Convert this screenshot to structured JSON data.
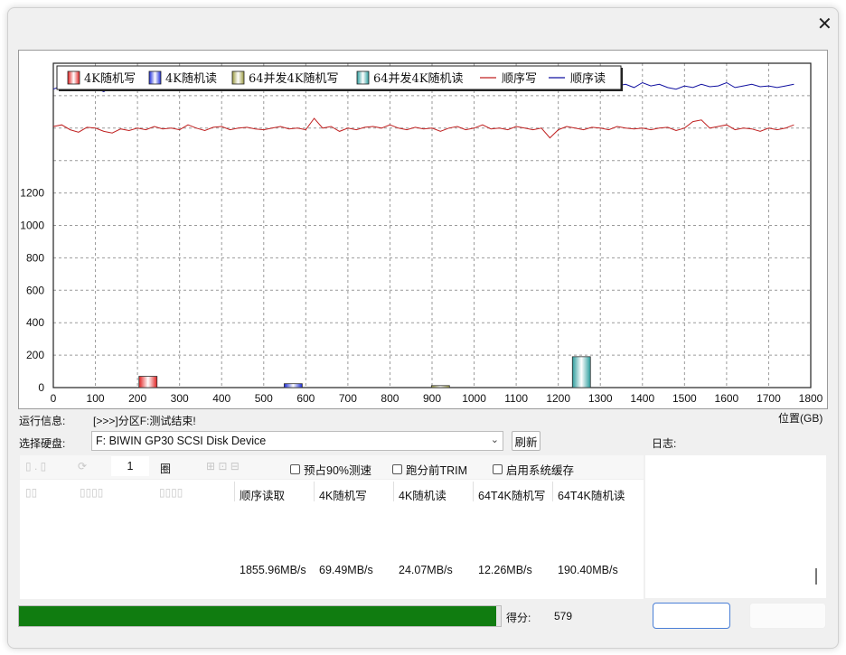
{
  "window": {
    "close_glyph": "✕"
  },
  "chart_data": {
    "type": "bar",
    "legend": [
      "4K随机写",
      "4K随机读",
      "64并发4K随机写",
      "64并发4K随机读",
      "顺序写",
      "顺序读"
    ],
    "legend_position": "top-left",
    "xlabel": "位置(GB)",
    "x_ticks": [
      0,
      100,
      200,
      300,
      400,
      500,
      600,
      700,
      800,
      900,
      1000,
      1100,
      1200,
      1300,
      1400,
      1500,
      1600,
      1700,
      1800
    ],
    "y_ticks": [
      0,
      200,
      400,
      600,
      800,
      1000,
      1200
    ],
    "xlim": [
      0,
      1800
    ],
    "ylim": [
      0,
      2000
    ],
    "grid": true,
    "bars": [
      {
        "name": "4K随机写",
        "x": 225,
        "value": 69.49,
        "color": "#e02020"
      },
      {
        "name": "4K随机读",
        "x": 570,
        "value": 24.07,
        "color": "#1a2ad8"
      },
      {
        "name": "64并发4K随机写",
        "x": 920,
        "value": 12.26,
        "color": "#9a9a40"
      },
      {
        "name": "64并发4K随机读",
        "x": 1255,
        "value": 190.4,
        "color": "#2a9c9c"
      }
    ],
    "series": [
      {
        "name": "顺序写",
        "color": "#c02020",
        "x": [
          0,
          20,
          40,
          60,
          80,
          100,
          120,
          140,
          160,
          180,
          200,
          220,
          240,
          260,
          280,
          300,
          320,
          340,
          360,
          380,
          400,
          420,
          440,
          460,
          480,
          500,
          520,
          540,
          560,
          580,
          600,
          620,
          640,
          660,
          680,
          700,
          720,
          740,
          760,
          780,
          800,
          820,
          840,
          860,
          880,
          900,
          920,
          940,
          960,
          980,
          1000,
          1020,
          1040,
          1060,
          1080,
          1100,
          1120,
          1140,
          1160,
          1180,
          1200,
          1220,
          1240,
          1260,
          1280,
          1300,
          1320,
          1340,
          1360,
          1380,
          1400,
          1420,
          1440,
          1460,
          1480,
          1500,
          1520,
          1540,
          1560,
          1580,
          1600,
          1620,
          1640,
          1660,
          1680,
          1700,
          1720,
          1740,
          1760
        ],
        "values": [
          1610,
          1620,
          1590,
          1575,
          1605,
          1600,
          1580,
          1570,
          1595,
          1585,
          1600,
          1590,
          1610,
          1595,
          1600,
          1590,
          1620,
          1600,
          1585,
          1605,
          1610,
          1590,
          1600,
          1605,
          1595,
          1590,
          1600,
          1610,
          1595,
          1600,
          1590,
          1660,
          1600,
          1610,
          1580,
          1600,
          1590,
          1605,
          1610,
          1600,
          1620,
          1600,
          1590,
          1605,
          1595,
          1600,
          1580,
          1600,
          1610,
          1590,
          1600,
          1620,
          1595,
          1600,
          1590,
          1610,
          1600,
          1590,
          1600,
          1540,
          1590,
          1610,
          1600,
          1590,
          1605,
          1600,
          1590,
          1610,
          1600,
          1595,
          1600,
          1590,
          1600,
          1605,
          1585,
          1600,
          1640,
          1650,
          1600,
          1610,
          1620,
          1590,
          1600,
          1595,
          1580,
          1600,
          1590,
          1600,
          1620
        ]
      },
      {
        "name": "顺序读",
        "color": "#1010a0",
        "x": [
          0,
          20,
          40,
          60,
          80,
          100,
          120,
          140,
          160,
          180,
          200,
          220,
          240,
          260,
          280,
          300,
          320,
          340,
          360,
          380,
          400,
          420,
          440,
          460,
          480,
          500,
          520,
          540,
          560,
          580,
          600,
          620,
          640,
          660,
          680,
          700,
          720,
          740,
          760,
          780,
          800,
          820,
          840,
          860,
          880,
          900,
          920,
          940,
          960,
          980,
          1000,
          1020,
          1040,
          1060,
          1080,
          1100,
          1120,
          1140,
          1160,
          1180,
          1200,
          1220,
          1240,
          1260,
          1280,
          1300,
          1320,
          1340,
          1360,
          1380,
          1400,
          1420,
          1440,
          1460,
          1480,
          1500,
          1520,
          1540,
          1560,
          1580,
          1600,
          1620,
          1640,
          1660,
          1680,
          1700,
          1720,
          1740,
          1760
        ],
        "values": [
          1840,
          1860,
          1830,
          1870,
          1880,
          1845,
          1825,
          1860,
          1880,
          1850,
          1870,
          1840,
          1880,
          1850,
          1900,
          1860,
          1880,
          1860,
          1870,
          1845,
          1890,
          1870,
          1850,
          1860,
          1880,
          1850,
          1870,
          1860,
          1880,
          1830,
          1860,
          1870,
          1850,
          1880,
          1860,
          1870,
          1850,
          1880,
          1860,
          1870,
          1850,
          1860,
          1880,
          1850,
          1870,
          1860,
          1850,
          1880,
          1850,
          1870,
          1860,
          1865,
          1855,
          1870,
          1860,
          1850,
          1870,
          1860,
          1850,
          1870,
          1860,
          1880,
          1850,
          1870,
          1860,
          1850,
          1880,
          1860,
          1870,
          1850,
          1880,
          1860,
          1870,
          1850,
          1840,
          1860,
          1850,
          1870,
          1855,
          1860,
          1880,
          1850,
          1860,
          1870,
          1855,
          1860,
          1850,
          1860,
          1870
        ]
      }
    ]
  },
  "status": {
    "label": "运行信息:",
    "text": "[>>>]分区F:测试结束!"
  },
  "disk": {
    "label": "选择硬盘:",
    "selected": "F: BIWIN GP30 SCSI Disk Device",
    "arrow": "⌄",
    "refresh_label": "刷新"
  },
  "log": {
    "label": "日志:"
  },
  "options": {
    "faded_left": "▯ . ▯",
    "faded_mid": "⟳",
    "quantity": "1",
    "unit": "圈",
    "faded_after": "⊞ ⊡ ⊟",
    "checks": [
      "预占90%测速",
      "跑分前TRIM",
      "启用系统缓存"
    ]
  },
  "results": {
    "faded_cols": [
      "▯▯",
      "▯▯▯▯",
      "▯▯▯▯"
    ],
    "columns": [
      {
        "header": "顺序读取",
        "value": "1855.96MB/s"
      },
      {
        "header": "4K随机写",
        "value": "69.49MB/s"
      },
      {
        "header": "4K随机读",
        "value": "24.07MB/s"
      },
      {
        "header": "64T4K随机写",
        "value": "12.26MB/s"
      },
      {
        "header": "64T4K随机读",
        "value": "190.40MB/s"
      }
    ]
  },
  "score": {
    "label": "得分:",
    "value": "579"
  },
  "progress": {
    "fraction": 0.99,
    "color": "#107c10"
  }
}
